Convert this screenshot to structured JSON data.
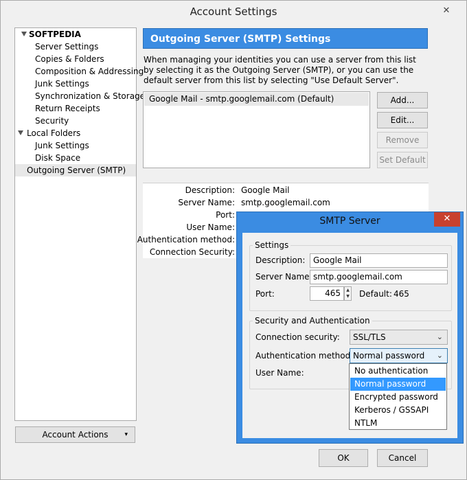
{
  "window": {
    "title": "Account Settings",
    "close": "✕"
  },
  "tree": {
    "account": "SOFTPEDIA",
    "account_items": [
      "Server Settings",
      "Copies & Folders",
      "Composition & Addressing",
      "Junk Settings",
      "Synchronization & Storage",
      "Return Receipts",
      "Security"
    ],
    "local": "Local Folders",
    "local_items": [
      "Junk Settings",
      "Disk Space"
    ],
    "outgoing": "Outgoing Server (SMTP)"
  },
  "account_actions": {
    "label": "Account Actions",
    "arrow": "▾"
  },
  "panel": {
    "header": "Outgoing Server (SMTP) Settings",
    "intro": "When managing your identities you can use a server from this list by selecting it as the Outgoing Server (SMTP), or you can use the default server from this list by selecting \"Use Default Server\".",
    "servers": [
      "Google Mail - smtp.googlemail.com (Default)"
    ],
    "buttons": {
      "add": "Add...",
      "edit": "Edit...",
      "remove": "Remove",
      "set_default": "Set Default"
    }
  },
  "details": {
    "description_label": "Description:",
    "description_value": "Google Mail",
    "server_label": "Server Name:",
    "server_value": "smtp.googlemail.com",
    "port_label": "Port:",
    "user_label": "User Name:",
    "auth_label": "Authentication method:",
    "security_label": "Connection Security:"
  },
  "footer": {
    "ok": "OK",
    "cancel": "Cancel"
  },
  "dialog": {
    "title": "SMTP Server",
    "close": "✕",
    "settings_group": "Settings",
    "description_label": "Description:",
    "description_value": "Google Mail",
    "server_label": "Server Name:",
    "server_value": "smtp.googlemail.com",
    "port_label": "Port:",
    "port_value": "465",
    "default_label": "Default:",
    "default_value": "465",
    "security_group": "Security and Authentication",
    "connection_label": "Connection security:",
    "connection_value": "SSL/TLS",
    "auth_label": "Authentication method:",
    "auth_value": "Normal password",
    "username_label": "User Name:",
    "auth_options": [
      "No authentication",
      "Normal password",
      "Encrypted password",
      "Kerberos / GSSAPI",
      "NTLM"
    ],
    "highlighted_option": "Normal password"
  },
  "colors": {
    "accent": "#3b8ce2",
    "highlight": "#3399ff",
    "close_red": "#c8412e"
  }
}
